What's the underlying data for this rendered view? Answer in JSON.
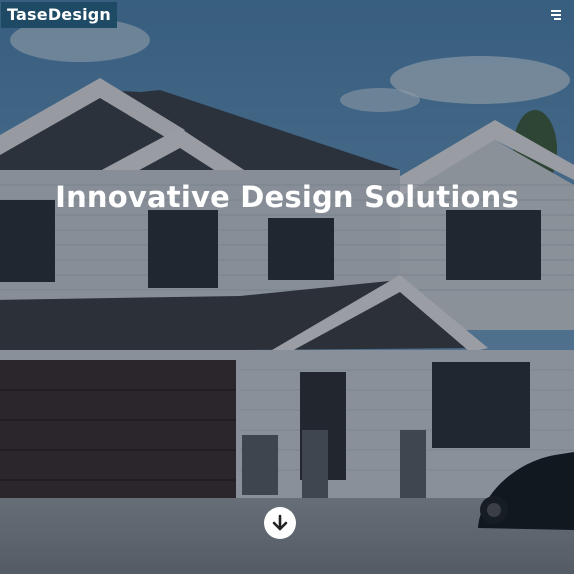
{
  "header": {
    "logo_text": "TaseDesign",
    "menu_icon": "hamburger-menu-icon"
  },
  "hero": {
    "title": "Innovative Design Solutions",
    "scroll_icon": "arrow-down-icon"
  },
  "colors": {
    "logo_background": "#1e4a66",
    "overlay": "#121e2c",
    "text": "#ffffff"
  }
}
